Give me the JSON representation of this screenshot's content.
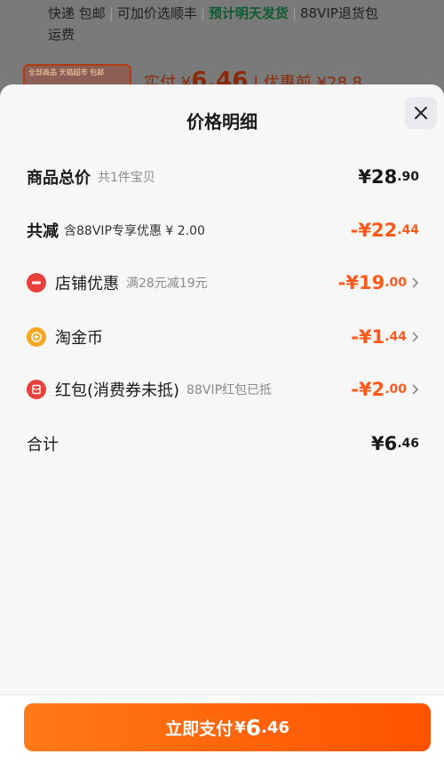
{
  "background": {
    "line1": [
      "快递 包邮",
      "可加价选顺丰",
      "预计明天发货",
      "88VIP退货包"
    ],
    "line2": "运费",
    "thumb_text": "全部商品 天猫超市 包邮",
    "price_prefix": "实付",
    "price_currency": "¥",
    "price_value": "6.46",
    "price_before": "| 优惠前 ¥28.8"
  },
  "sheet": {
    "title": "价格明细",
    "close_icon": "close-icon",
    "rows": [
      {
        "label": "商品总价",
        "sub": "共1件宝贝",
        "amount_int": "¥28",
        "amount_dec": ".90",
        "style": "normal"
      },
      {
        "label": "共减",
        "sub": "含88VIP专享优惠 ¥ 2.00",
        "amount_int": "-¥22",
        "amount_dec": ".44",
        "style": "orange"
      },
      {
        "label": "店铺优惠",
        "sub": "满28元减19元",
        "amount_int": "-¥19",
        "amount_dec": ".00",
        "icon": "store-coupon-icon",
        "icon_color": "#e8413d"
      },
      {
        "label": "淘金币",
        "sub": "",
        "amount_int": "-¥1",
        "amount_dec": ".44",
        "icon": "gold-coin-icon",
        "icon_color": "#f5a623"
      },
      {
        "label": "红包(消费券未抵)",
        "sub": "88VIP红包已抵",
        "amount_int": "-¥2",
        "amount_dec": ".00",
        "icon": "red-envelope-icon",
        "icon_color": "#e8413d"
      },
      {
        "label": "合计",
        "sub": "",
        "amount_int": "¥6",
        "amount_dec": ".46",
        "style": "normal"
      }
    ]
  },
  "pay_button": {
    "label": "立即支付",
    "currency": "¥",
    "int": "6",
    "dec": ".46"
  },
  "colors": {
    "accent": "#ff5a1a",
    "button_start": "#ff7a18",
    "button_end": "#ff5200"
  }
}
